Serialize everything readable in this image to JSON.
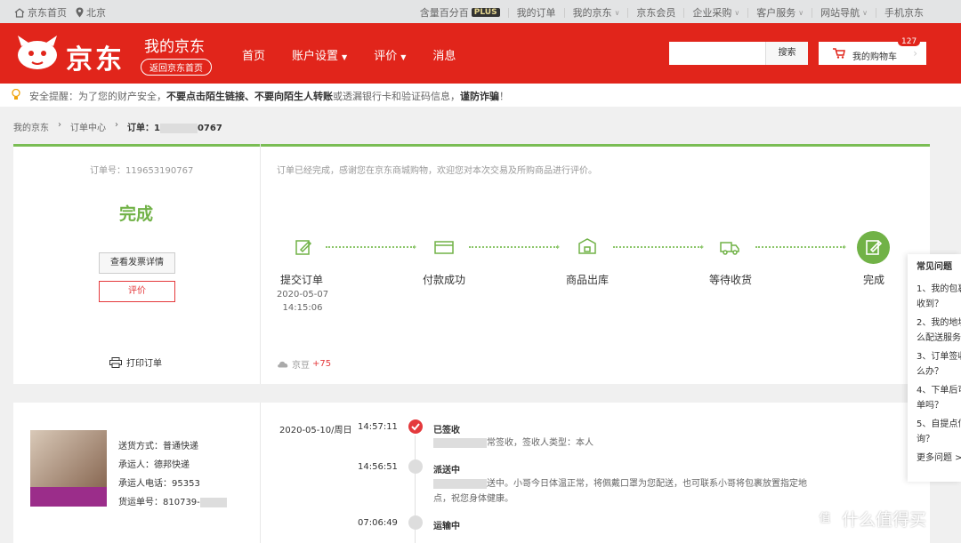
{
  "topbar": {
    "home": "京东首页",
    "city": "北京",
    "links": [
      "含量百分百",
      "我的订单",
      "我的京东",
      "京东会员",
      "企业采购",
      "客户服务",
      "网站导航",
      "手机京东"
    ],
    "plus_badge": "PLUS"
  },
  "header": {
    "logo_text": "京东",
    "title": "我的京东",
    "back_home": "返回京东首页",
    "nav": [
      "首页",
      "账户设置",
      "评价",
      "消息"
    ],
    "search_placeholder": "",
    "search_button": "搜索",
    "cart_label": "我的购物车",
    "cart_count": "127",
    "brand_color": "#e1251b"
  },
  "alert": {
    "prefix": "安全提醒：为了您的财产安全，",
    "bold1": "不要点击陌生链接、不要向陌生人转账",
    "middle": "或透漏银行卡和验证码信息，",
    "bold2": "谨防诈骗",
    "suffix": "！"
  },
  "breadcrumb": {
    "items": [
      "我的京东",
      "订单中心"
    ],
    "current_prefix": "订单：1",
    "current_suffix": "0767"
  },
  "order": {
    "number": "订单号：119653190767",
    "status": "完成",
    "invoice_button": "查看发票详情",
    "rate_button": "评价",
    "print": "打印订单",
    "message": "订单已经完成，感谢您在京东商城购物，欢迎您对本次交易及所购商品进行评价。",
    "beans_label": "京豆",
    "beans_value": "+75",
    "status_color": "#71b247"
  },
  "steps": [
    {
      "label": "提交订单",
      "icon": "edit-icon",
      "date": "2020-05-07",
      "time": "14:15:06"
    },
    {
      "label": "付款成功",
      "icon": "card-icon"
    },
    {
      "label": "商品出库",
      "icon": "box-icon"
    },
    {
      "label": "等待收货",
      "icon": "truck-icon"
    },
    {
      "label": "完成",
      "icon": "done-icon"
    }
  ],
  "delivery": {
    "method": "送货方式：普通快递",
    "carrier": "承运人：德邦快递",
    "phone": "承运人电话：95353",
    "waybill": "货运单号：810739-"
  },
  "timeline": [
    {
      "date": "2020-05-10/周日",
      "time": "14:57:11",
      "title": "已签收",
      "desc": "常签收，签收人类型：本人"
    },
    {
      "date": "",
      "time": "14:56:51",
      "title": "派送中",
      "desc1": "送中。小哥今日体温正常，将佩戴口罩为您配送，也可联系小哥将包裹放置指定地",
      "desc2": "点，祝您身体健康。"
    },
    {
      "date": "",
      "time": "07:06:49",
      "title": "运输中"
    }
  ],
  "faq": {
    "title": "常见问题",
    "items": [
      "1、我的包裹",
      "收到？",
      "2、我的地址",
      "么配送服务",
      "3、订单签收",
      "么办？",
      "4、下单后可",
      "单吗？",
      "5、自提点信",
      "询？"
    ],
    "more": "更多问题 >"
  },
  "watermark": {
    "circle": "值",
    "text": "什么值得买"
  }
}
